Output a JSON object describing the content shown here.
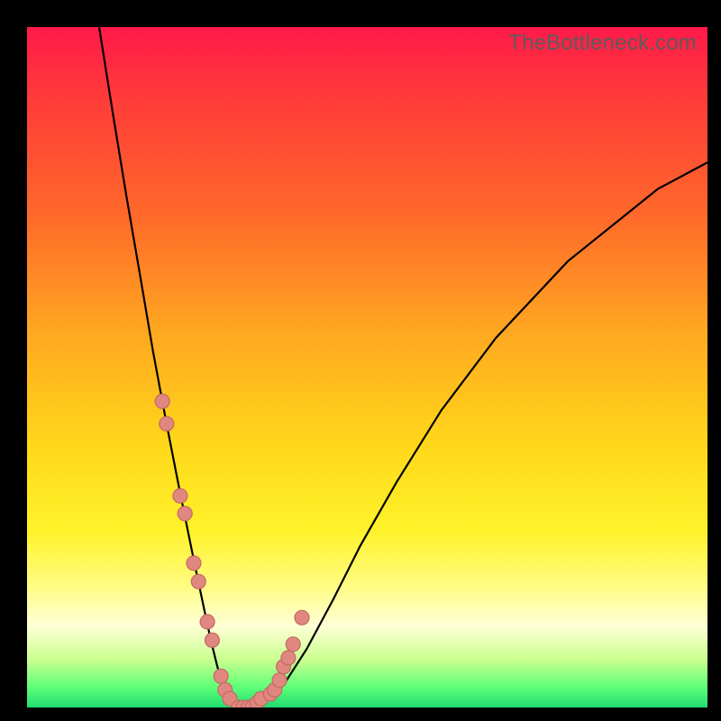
{
  "watermark": "TheBottleneck.com",
  "colors": {
    "frame": "#000000",
    "dot_fill": "#e08780",
    "dot_stroke": "#c36a63",
    "curve": "#000000"
  },
  "chart_data": {
    "type": "line",
    "title": "",
    "xlabel": "",
    "ylabel": "",
    "xlim": [
      0,
      100
    ],
    "ylim": [
      0,
      100
    ],
    "note": "No axes or ticks are shown; v-shaped curve on gradient background. x maps left→right across plot, y maps bottom→top (0 = bottom). Values estimated from pixel positions.",
    "series": [
      {
        "name": "v-curve",
        "x": [
          10.6,
          12.6,
          14.6,
          16.6,
          18.5,
          20.5,
          22.5,
          24.5,
          26.0,
          27.0,
          28.0,
          29.0,
          30.0,
          31.0,
          32.0,
          33.0,
          35.0,
          37.7,
          41.1,
          45.0,
          49.0,
          54.3,
          60.9,
          68.9,
          79.5,
          92.7,
          100.0
        ],
        "y": [
          100.0,
          87.4,
          75.2,
          63.6,
          52.4,
          41.7,
          31.5,
          21.7,
          14.6,
          9.9,
          5.9,
          3.3,
          1.3,
          0.3,
          0.0,
          0.0,
          0.7,
          3.3,
          8.6,
          15.9,
          23.8,
          33.1,
          43.7,
          54.3,
          65.6,
          76.2,
          80.1
        ]
      }
    ],
    "points": {
      "name": "highlighted-dots",
      "description": "Salmon circular markers on lower portions of both arms of the V.",
      "x": [
        19.9,
        20.5,
        22.5,
        23.2,
        24.5,
        25.2,
        26.5,
        27.2,
        28.5,
        29.1,
        29.8,
        31.1,
        31.8,
        32.5,
        33.1,
        33.8,
        34.4,
        35.8,
        36.4,
        37.1,
        37.7,
        38.4,
        39.1,
        40.4
      ],
      "y": [
        45.0,
        41.7,
        31.1,
        28.5,
        21.2,
        18.5,
        12.6,
        9.9,
        4.6,
        2.6,
        1.3,
        0.0,
        0.0,
        0.0,
        0.0,
        0.7,
        1.3,
        2.0,
        2.6,
        4.0,
        6.0,
        7.3,
        9.3,
        13.2
      ]
    }
  }
}
